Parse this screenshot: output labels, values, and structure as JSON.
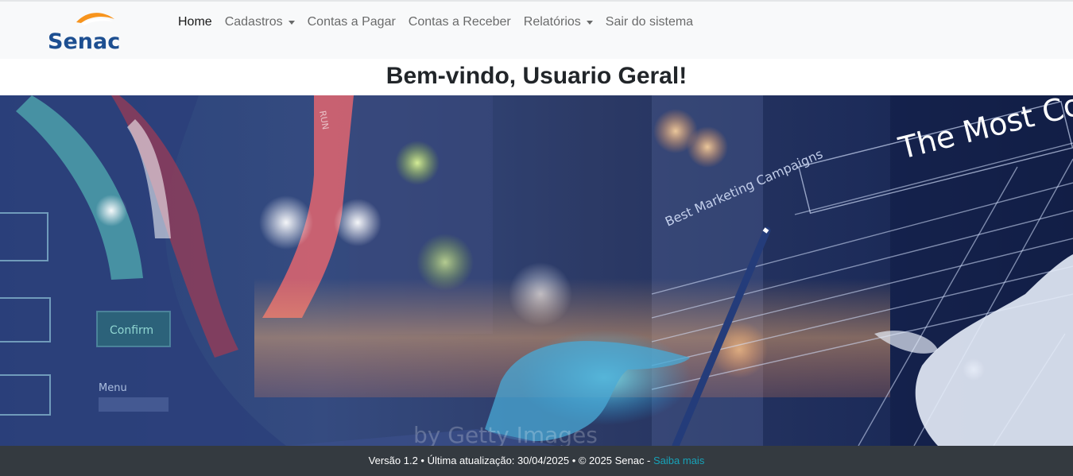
{
  "brand": {
    "logo_text": "Senac"
  },
  "nav": {
    "home": "Home",
    "cadastros": "Cadastros",
    "contas_pagar": "Contas a Pagar",
    "contas_receber": "Contas a Receber",
    "relatorios": "Relatórios",
    "sair": "Sair do sistema"
  },
  "welcome": {
    "title": "Bem-vindo, Usuario Geral!"
  },
  "hero": {
    "overlay_heading": "The Most Co",
    "overlay_campaigns": "Best Marketing Campaigns",
    "overlay_button": "Confirm",
    "overlay_menu": "Menu",
    "watermark": "by Getty Images",
    "side_tag": "RUN"
  },
  "footer": {
    "text": "Versão 1.2 • Última atualização: 30/04/2025 • © 2025 Senac - ",
    "link": "Saiba mais"
  },
  "colors": {
    "navbar_bg": "#f8f9fa",
    "footer_bg": "#343a40",
    "footer_link": "#17a2b8",
    "logo_blue": "#1d4f91",
    "logo_orange": "#f7941d"
  }
}
